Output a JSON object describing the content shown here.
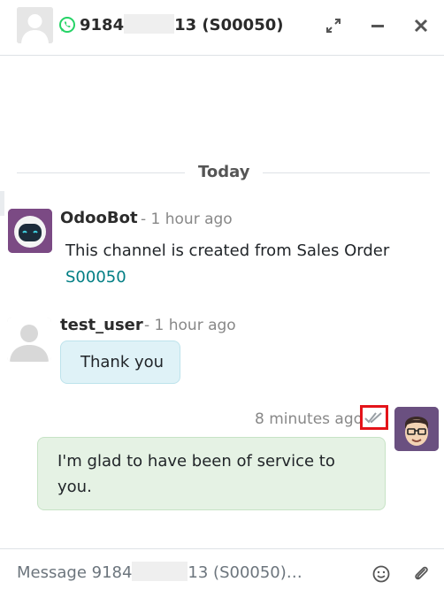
{
  "header": {
    "title_prefix": "9184",
    "title_suffix": "13 (S00050)"
  },
  "date_separator": "Today",
  "messages": [
    {
      "author": "OdooBot",
      "time": "- 1 hour ago",
      "text": "This channel is created from Sales Order",
      "link": "S00050"
    },
    {
      "author": "test_user",
      "time": "- 1 hour ago",
      "text": "Thank you"
    },
    {
      "time": "8 minutes ago",
      "text_line1": "I'm glad to have been of service to",
      "text_line2": "you."
    }
  ],
  "composer": {
    "placeholder_prefix": "Message 9184",
    "placeholder_suffix": "13 (S00050)…"
  },
  "colors": {
    "whatsapp": "#25d366",
    "link": "#017e84",
    "highlight": "#e4141a",
    "received_bubble": "#dff2f7",
    "sent_bubble": "#e5f2e4"
  }
}
